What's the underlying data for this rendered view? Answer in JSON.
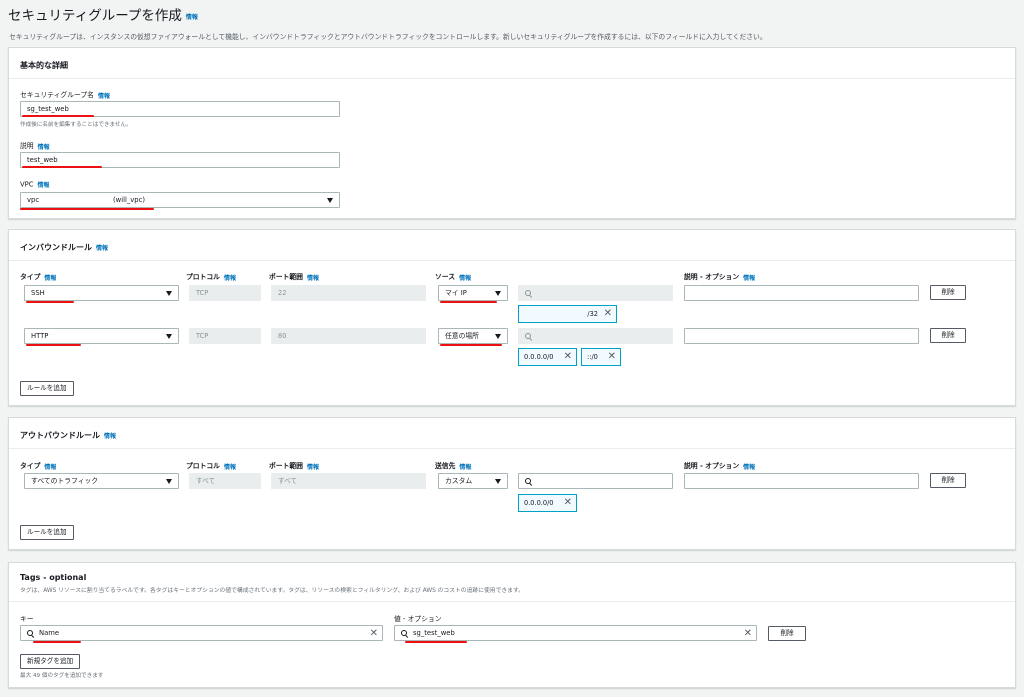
{
  "page": {
    "title": "セキュリティグループを作成",
    "title_info": "情報",
    "description": "セキュリティグループは、インスタンスの仮想ファイアウォールとして機能し、インバウンドトラフィックとアウトバウンドトラフィックをコントロールします。新しいセキュリティグループを作成するには、以下のフィールドに入力してください。"
  },
  "basic": {
    "title": "基本的な詳細",
    "name_label": "セキュリティグループ名",
    "name_info": "情報",
    "name_value": "sg_test_web",
    "name_hint": "作成後に名前を編集することはできません。",
    "desc_label": "説明",
    "desc_info": "情報",
    "desc_value": "test_web",
    "vpc_label": "VPC",
    "vpc_info": "情報",
    "vpc_value": "vpc",
    "vpc_suffix": "(will_vpc)"
  },
  "columns": {
    "type": "タイプ",
    "protocol": "プロトコル",
    "port": "ポート範囲",
    "source": "ソース",
    "dest": "送信先",
    "descopt": "説明 - オプション",
    "info": "情報"
  },
  "inbound": {
    "title": "インバウンドルール",
    "info": "情報",
    "rules": [
      {
        "type": "SSH",
        "protocol": "TCP",
        "port": "22",
        "source": "マイ IP",
        "token": "/32",
        "delete": "削除"
      },
      {
        "type": "HTTP",
        "protocol": "TCP",
        "port": "80",
        "source": "任意の場所",
        "token1": "0.0.0.0/0",
        "token2": "::/0",
        "delete": "削除"
      }
    ],
    "add_button": "ルールを追加"
  },
  "outbound": {
    "title": "アウトバウンドルール",
    "info": "情報",
    "rule": {
      "type": "すべてのトラフィック",
      "protocol": "すべて",
      "port": "すべて",
      "dest": "カスタム",
      "token": "0.0.0.0/0",
      "delete": "削除"
    },
    "add_button": "ルールを追加"
  },
  "tags": {
    "title": "Tags - optional",
    "description": "タグは、AWS リソースに割り当てるラベルです。各タグはキーとオプションの値で構成されています。タグは、リソースの検索とフィルタリング、および AWS のコストの追跡に使用できます。",
    "key_label": "キー",
    "value_label": "値 - オプション",
    "key_value": "Name",
    "value_value": "sg_test_web",
    "delete": "削除",
    "add_button": "新規タグを追加",
    "limit_hint": "最大 49 個のタグを追加できます"
  },
  "icons": {
    "search": "search-icon",
    "close": "close-icon",
    "dropdown": "caret-down-icon"
  },
  "colors": {
    "link": "#0073bb",
    "token_border": "#00a1c9",
    "annotation": "#ee1111"
  }
}
